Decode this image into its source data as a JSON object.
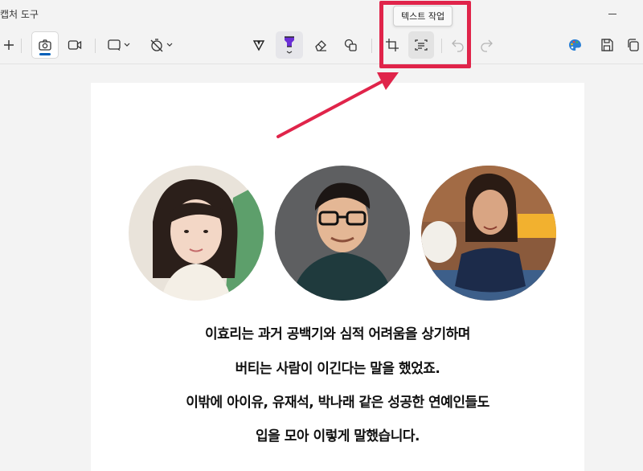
{
  "window": {
    "title": "캡처 도구"
  },
  "tooltip": {
    "text": "텍스트 작업"
  },
  "toolbar": {
    "new": "new-capture",
    "icons": [
      "plus-icon",
      "camera-icon",
      "video-icon",
      "rectangle-icon",
      "timer-off-icon",
      "ballpoint-pen-icon",
      "highlighter-icon",
      "eraser-icon",
      "shapes-icon",
      "crop-icon",
      "text-actions-icon",
      "undo-icon",
      "redo-icon",
      "color-palette-icon",
      "save-icon",
      "copy-icon"
    ]
  },
  "colors": {
    "accent": "#005fb8",
    "annotation": "#e0244a",
    "highlighter": "#6b2fd6"
  },
  "content": {
    "lines": [
      "이효리는 과거 공백기와 심적 어려움을 상기하며",
      "버티는 사람이 이긴다는 말을 했었죠.",
      "이밖에 아이유, 유재석, 박나래 같은 성공한 연예인들도",
      "입을 모아 이렇게 말했습니다."
    ]
  }
}
